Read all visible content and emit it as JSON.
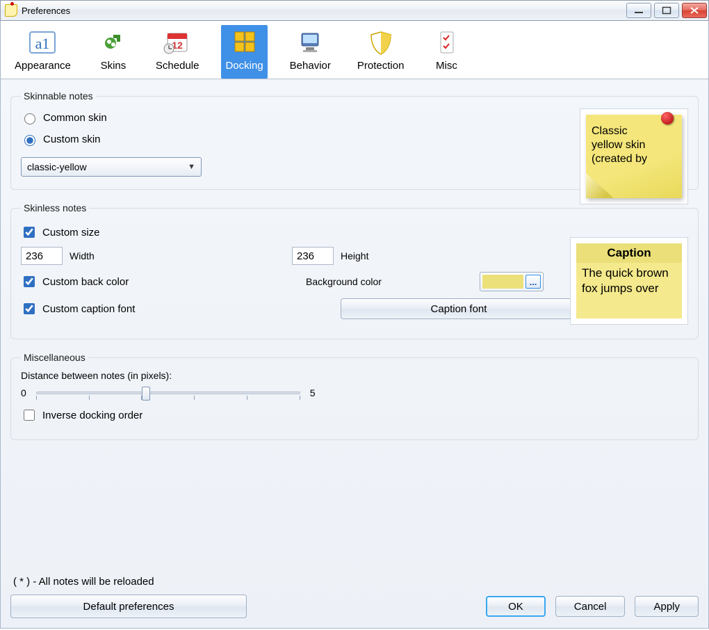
{
  "window": {
    "title": "Preferences"
  },
  "tabs": [
    {
      "label": "Appearance"
    },
    {
      "label": "Skins"
    },
    {
      "label": "Schedule"
    },
    {
      "label": "Docking",
      "active": true
    },
    {
      "label": "Behavior"
    },
    {
      "label": "Protection"
    },
    {
      "label": "Misc"
    }
  ],
  "skinnable": {
    "legend": "Skinnable notes",
    "common": "Common skin",
    "custom": "Custom skin",
    "selected_skin": "classic-yellow",
    "preview_line1": "Classic",
    "preview_line2": "yellow skin",
    "preview_line3": "(created by"
  },
  "skinless": {
    "legend": "Skinless notes",
    "custom_size": "Custom size",
    "width_value": "236",
    "width_label": "Width",
    "height_value": "236",
    "height_label": "Height",
    "custom_back": "Custom back color",
    "bgcolor_label": "Background color",
    "bgcolor_hex": "#ece07a",
    "custom_caption": "Custom caption font",
    "caption_btn": "Caption font",
    "preview_caption": "Caption",
    "preview_body": "The quick brown fox jumps over"
  },
  "misc": {
    "legend": "Miscellaneous",
    "distance_label": "Distance between notes (in pixels):",
    "min": "0",
    "max": "5",
    "inverse": "Inverse docking order"
  },
  "footer": {
    "note": "( * ) - All notes will be reloaded",
    "defaults": "Default preferences",
    "ok": "OK",
    "cancel": "Cancel",
    "apply": "Apply"
  }
}
